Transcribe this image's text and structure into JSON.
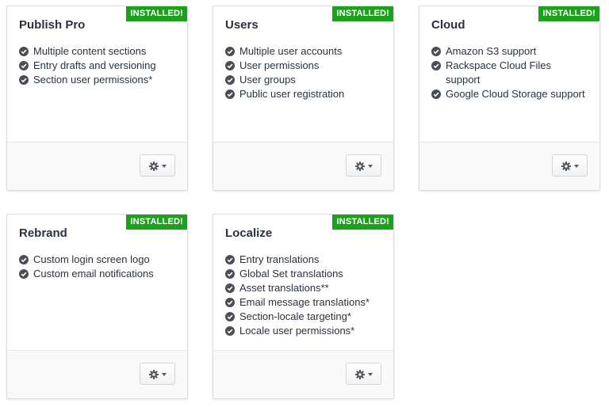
{
  "colors": {
    "badge": "#1da11d",
    "text": "#29323d",
    "footer": "#f9f9f9"
  },
  "icons": {
    "check": "check-circle-icon",
    "settings": "gear-icon",
    "dropdown": "caret-down-icon"
  },
  "editions": [
    {
      "name": "Publish Pro",
      "badge": "INSTALLED!",
      "features": [
        "Multiple content sections",
        "Entry drafts and versioning",
        "Section user permissions*"
      ]
    },
    {
      "name": "Users",
      "badge": "INSTALLED!",
      "features": [
        "Multiple user accounts",
        "User permissions",
        "User groups",
        "Public user registration"
      ]
    },
    {
      "name": "Cloud",
      "badge": "INSTALLED!",
      "features": [
        "Amazon S3 support",
        "Rackspace Cloud Files support",
        "Google Cloud Storage support"
      ]
    },
    {
      "name": "Rebrand",
      "badge": "INSTALLED!",
      "features": [
        "Custom login screen logo",
        "Custom email notifications"
      ]
    },
    {
      "name": "Localize",
      "badge": "INSTALLED!",
      "features": [
        "Entry translations",
        "Global Set translations",
        "Asset translations**",
        "Email message translations*",
        "Section-locale targeting*",
        "Locale user permissions*"
      ]
    }
  ]
}
